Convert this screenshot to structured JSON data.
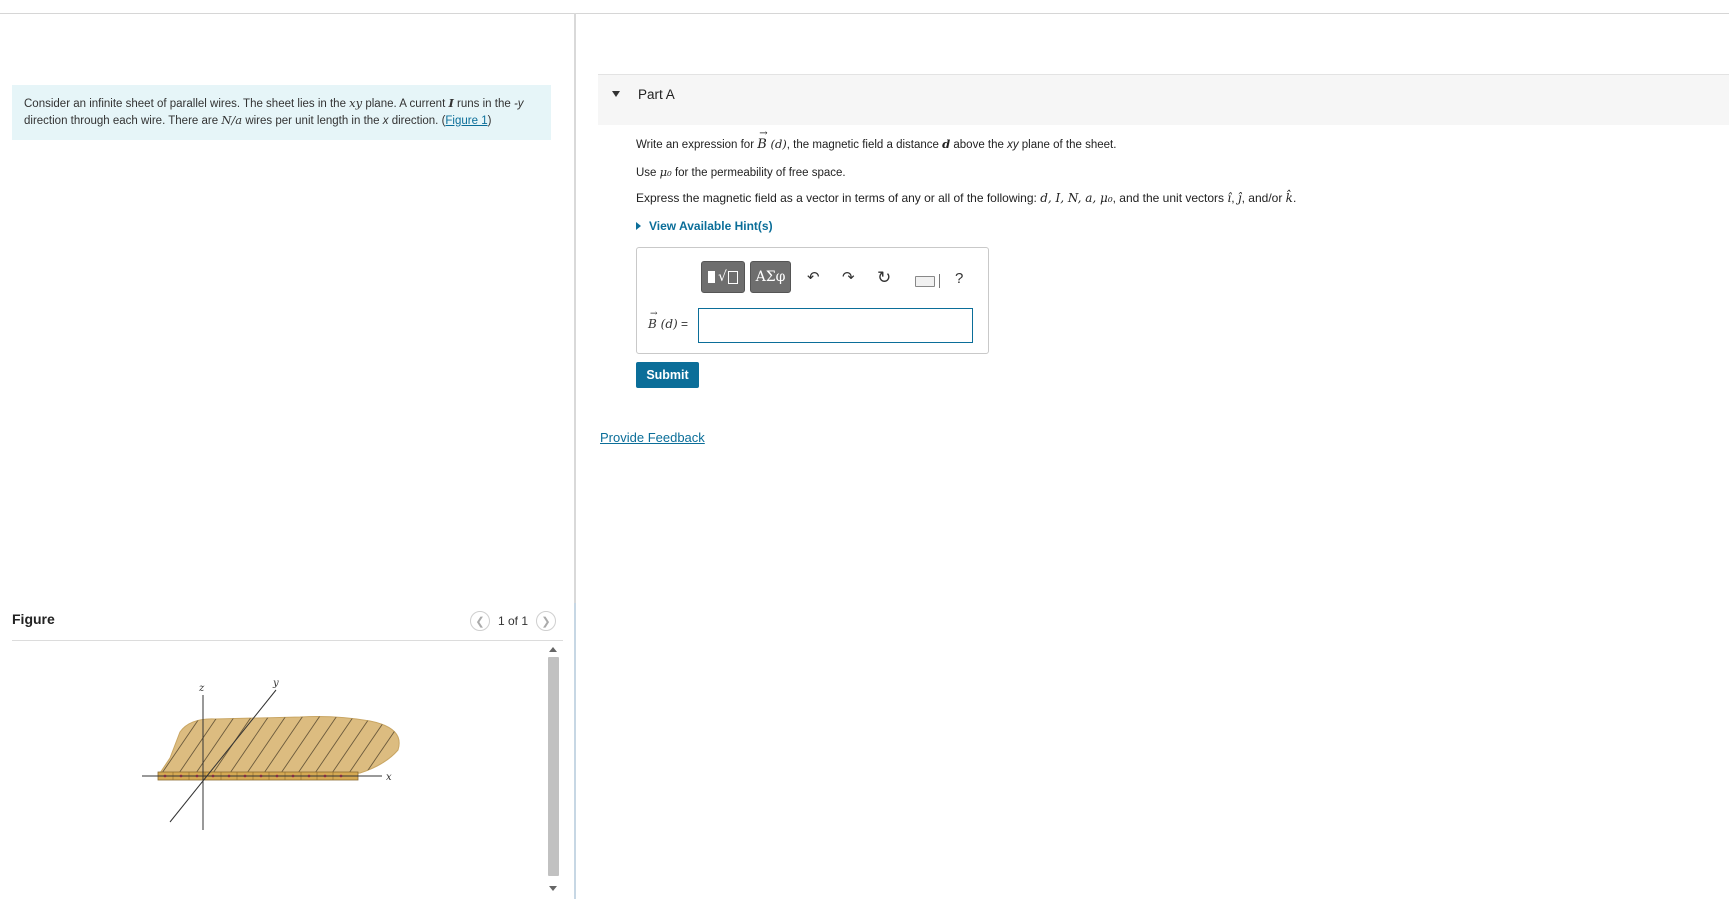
{
  "problem": {
    "text_1": "Consider an infinite sheet of parallel wires. The sheet lies in the ",
    "sym_xy": "xy",
    "text_2": " plane. A current ",
    "sym_I": "I",
    "text_3": " runs in the ",
    "sym_negy": "-y",
    "text_4": " direction through each wire. There are ",
    "sym_Na": "N/a",
    "text_5": " wires per unit length in the ",
    "sym_x": "x",
    "text_6": " direction. (",
    "figure_link": "Figure 1",
    "text_7": ")"
  },
  "figure": {
    "title": "Figure",
    "pager": "1 of 1",
    "labels": {
      "z": "z",
      "y": "y",
      "x": "x"
    },
    "colors": {
      "sheet": "#dcbc80",
      "sheet_edge": "#c9a663",
      "hatch": "#6b5a3c",
      "dot": "#c8325a"
    }
  },
  "part": {
    "label": "Part A",
    "q1_a": "Write an expression for ",
    "q1_B": "B",
    "q1_arg": " (d)",
    "q1_b": ", the magnetic field a distance ",
    "q1_d": "d",
    "q1_c": " above the ",
    "q1_xy": "xy",
    "q1_e": " plane of the sheet.",
    "q2_a": "Use ",
    "q2_mu": "μ₀",
    "q2_b": " for the permeability of free space.",
    "q3_a": "Express the magnetic field as a vector in terms of any or all of the following: ",
    "q3_vars": "d, I, N, a, μ₀",
    "q3_b": ", and the unit vectors ",
    "q3_i": "î",
    "q3_c": ", ",
    "q3_j": "ĵ",
    "q3_d": ", and/or ",
    "q3_k": "k̂",
    "q3_e": ".",
    "hints": "View Available Hint(s)",
    "answer_label": "B (d)",
    "equals": " =",
    "submit": "Submit"
  },
  "toolbar": {
    "greek": "ΑΣφ",
    "template": "√",
    "undo": "↶",
    "redo": "↷",
    "reset": "↻",
    "help": "?"
  },
  "feedback": "Provide Feedback",
  "colors": {
    "accent": "#0b6e99",
    "intro_bg": "#e6f5f8"
  }
}
